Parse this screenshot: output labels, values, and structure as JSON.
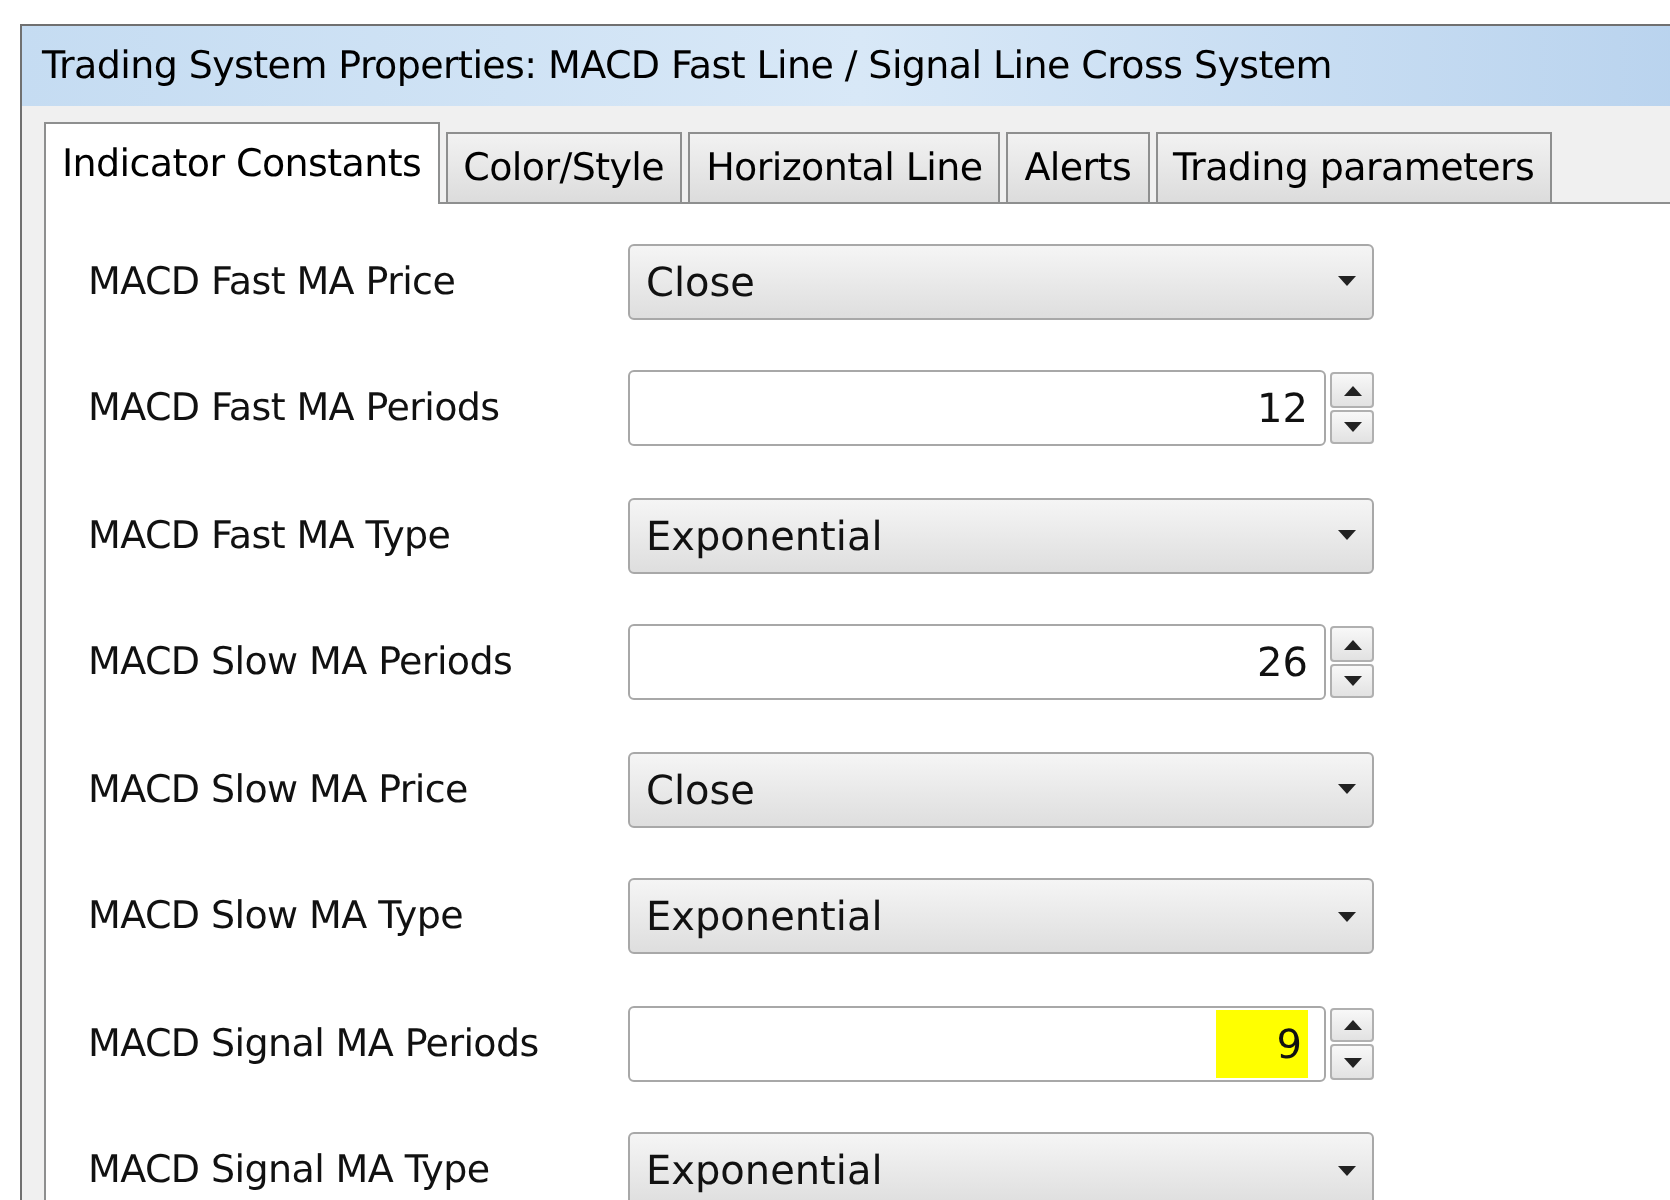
{
  "window": {
    "title": "Trading System Properties: MACD Fast Line / Signal Line Cross System"
  },
  "tabs": [
    {
      "label": "Indicator Constants",
      "selected": true
    },
    {
      "label": "Color/Style",
      "selected": false
    },
    {
      "label": "Horizontal Line",
      "selected": false
    },
    {
      "label": "Alerts",
      "selected": false
    },
    {
      "label": "Trading parameters",
      "selected": false
    }
  ],
  "fields": [
    {
      "label": "MACD Fast MA Price",
      "kind": "dropdown",
      "value": "Close"
    },
    {
      "label": "MACD Fast MA Periods",
      "kind": "spin",
      "value": "12",
      "highlighted": false
    },
    {
      "label": "MACD Fast MA Type",
      "kind": "dropdown",
      "value": "Exponential"
    },
    {
      "label": "MACD Slow MA Periods",
      "kind": "spin",
      "value": "26",
      "highlighted": false
    },
    {
      "label": "MACD Slow MA Price",
      "kind": "dropdown",
      "value": "Close"
    },
    {
      "label": "MACD Slow MA Type",
      "kind": "dropdown",
      "value": "Exponential"
    },
    {
      "label": "MACD Signal MA Periods",
      "kind": "spin",
      "value": "9",
      "highlighted": true
    },
    {
      "label": "MACD Signal MA Type",
      "kind": "dropdown",
      "value": "Exponential"
    }
  ]
}
